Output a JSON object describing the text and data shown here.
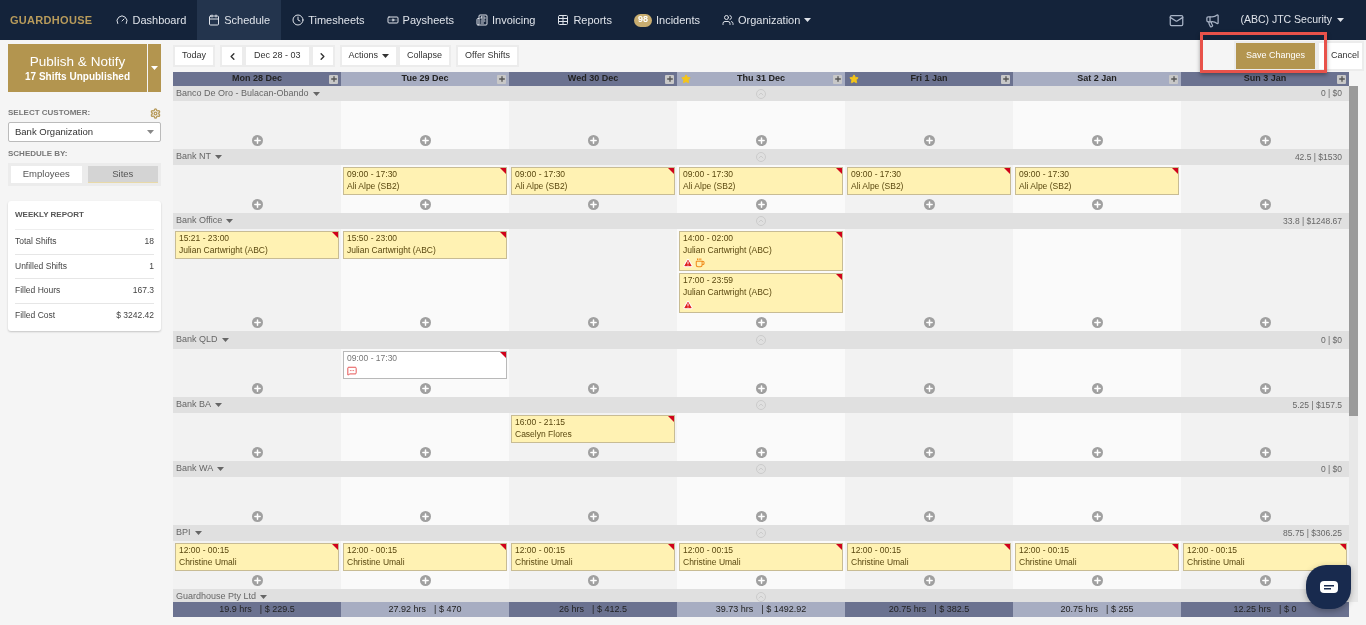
{
  "nav": {
    "logo": "GUARDHOUSE",
    "items": [
      {
        "kind": "gauge",
        "label": "Dashboard",
        "selected": false
      },
      {
        "kind": "calendar",
        "label": "Schedule",
        "selected": true
      },
      {
        "kind": "clock",
        "label": "Timesheets",
        "selected": false
      },
      {
        "kind": "money",
        "label": "Paysheets",
        "selected": false
      },
      {
        "kind": "invoice",
        "label": "Invoicing",
        "selected": false
      },
      {
        "kind": "table",
        "label": "Reports",
        "selected": false
      },
      {
        "kind": "badge",
        "badge": "98",
        "label": "Incidents",
        "selected": false
      },
      {
        "kind": "people",
        "label": "Organization",
        "selected": false
      }
    ],
    "account": "(ABC) JTC Security"
  },
  "publish": {
    "title": "Publish & Notify",
    "subtitle": "17 Shifts Unpublished"
  },
  "customer": {
    "label": "SELECT CUSTOMER:",
    "value": "Bank Organization"
  },
  "schedule_by": {
    "label": "SCHEDULE BY:",
    "options": [
      {
        "label": "Employees",
        "selected": false
      },
      {
        "label": "Sites",
        "selected": true
      }
    ]
  },
  "weekly_report": {
    "title": "WEEKLY REPORT",
    "rows": [
      {
        "label": "Total Shifts",
        "value": "18"
      },
      {
        "label": "Unfilled Shifts",
        "value": "1"
      },
      {
        "label": "Filled Hours",
        "value": "167.3"
      },
      {
        "label": "Filled Cost",
        "value": "$ 3242.42"
      }
    ]
  },
  "toolbar": {
    "today": "Today",
    "range": "Dec 28 - 03",
    "actions": "Actions",
    "collapse": "Collapse",
    "offer": "Offer Shifts",
    "save": "Save Changes",
    "cancel": "Cancel"
  },
  "days": [
    {
      "label": "Mon 28 Dec",
      "starred": false
    },
    {
      "label": "Tue 29 Dec",
      "starred": false
    },
    {
      "label": "Wed 30 Dec",
      "starred": false
    },
    {
      "label": "Thu 31 Dec",
      "starred": true
    },
    {
      "label": "Fri 1 Jan",
      "starred": true
    },
    {
      "label": "Sat 2 Jan",
      "starred": false
    },
    {
      "label": "Sun 3 Jan",
      "starred": false
    }
  ],
  "sites": [
    {
      "name": "Banco De Oro - Bulacan-Obando",
      "summary": "0 | $0",
      "cells": [
        [],
        [],
        [],
        [],
        [],
        [],
        []
      ]
    },
    {
      "name": "Bank NT",
      "summary": "42.5 | $1530",
      "cells": [
        [],
        [
          {
            "kind": "filled",
            "time": "09:00 - 17:30",
            "employee": "Ali Alpe (SB2)"
          }
        ],
        [
          {
            "kind": "filled",
            "time": "09:00 - 17:30",
            "employee": "Ali Alpe (SB2)"
          }
        ],
        [
          {
            "kind": "filled",
            "time": "09:00 - 17:30",
            "employee": "Ali Alpe (SB2)"
          }
        ],
        [
          {
            "kind": "filled",
            "time": "09:00 - 17:30",
            "employee": "Ali Alpe (SB2)"
          }
        ],
        [
          {
            "kind": "filled",
            "time": "09:00 - 17:30",
            "employee": "Ali Alpe (SB2)"
          }
        ],
        []
      ]
    },
    {
      "name": "Bank Office",
      "summary": "33.8 | $1248.67",
      "cells": [
        [
          {
            "kind": "filled",
            "time": "15:21 - 23:00",
            "employee": "Julian Cartwright (ABC)"
          }
        ],
        [
          {
            "kind": "filled",
            "time": "15:50 - 23:00",
            "employee": "Julian Cartwright (ABC)"
          }
        ],
        [],
        [
          {
            "kind": "filled",
            "time": "14:00 - 02:00",
            "employee": "Julian Cartwright (ABC)",
            "flags": [
              {
                "kind": "warning"
              },
              {
                "kind": "break"
              }
            ]
          },
          {
            "kind": "filled",
            "time": "17:00 - 23:59",
            "employee": "Julian Cartwright (ABC)",
            "flags": [
              {
                "kind": "warning"
              }
            ]
          }
        ],
        [],
        [],
        []
      ]
    },
    {
      "name": "Bank QLD",
      "summary": "0 | $0",
      "cells": [
        [],
        [
          {
            "kind": "open",
            "time": "09:00 - 17:30",
            "flags": [
              {
                "kind": "comment"
              }
            ]
          }
        ],
        [],
        [],
        [],
        [],
        []
      ]
    },
    {
      "name": "Bank BA",
      "summary": "5.25 | $157.5",
      "cells": [
        [],
        [],
        [
          {
            "kind": "filled",
            "time": "16:00 - 21:15",
            "employee": "Caselyn Flores"
          }
        ],
        [],
        [],
        [],
        []
      ]
    },
    {
      "name": "Bank WA",
      "summary": "0 | $0",
      "cells": [
        [],
        [],
        [],
        [],
        [],
        [],
        []
      ]
    },
    {
      "name": "BPI",
      "summary": "85.75 | $306.25",
      "cells": [
        [
          {
            "kind": "filled",
            "time": "12:00 - 00:15",
            "employee": "Christine Umali"
          }
        ],
        [
          {
            "kind": "filled",
            "time": "12:00 - 00:15",
            "employee": "Christine Umali"
          }
        ],
        [
          {
            "kind": "filled",
            "time": "12:00 - 00:15",
            "employee": "Christine Umali"
          }
        ],
        [
          {
            "kind": "filled",
            "time": "12:00 - 00:15",
            "employee": "Christine Umali"
          }
        ],
        [
          {
            "kind": "filled",
            "time": "12:00 - 00:15",
            "employee": "Christine Umali"
          }
        ],
        [
          {
            "kind": "filled",
            "time": "12:00 - 00:15",
            "employee": "Christine Umali"
          }
        ],
        [
          {
            "kind": "filled",
            "time": "12:00 - 00:15",
            "employee": "Christine Umali"
          }
        ]
      ]
    },
    {
      "name": "Guardhouse Pty Ltd"
    }
  ],
  "totals": [
    {
      "hours": "19.9 hrs",
      "cost": "| $ 229.5"
    },
    {
      "hours": "27.92 hrs",
      "cost": "| $ 470"
    },
    {
      "hours": "26 hrs",
      "cost": "| $ 412.5"
    },
    {
      "hours": "39.73 hrs",
      "cost": "| $ 1492.92"
    },
    {
      "hours": "20.75 hrs",
      "cost": "| $ 382.5"
    },
    {
      "hours": "20.75 hrs",
      "cost": "| $ 255"
    },
    {
      "hours": "12.25 hrs",
      "cost": "| $ 0"
    }
  ]
}
